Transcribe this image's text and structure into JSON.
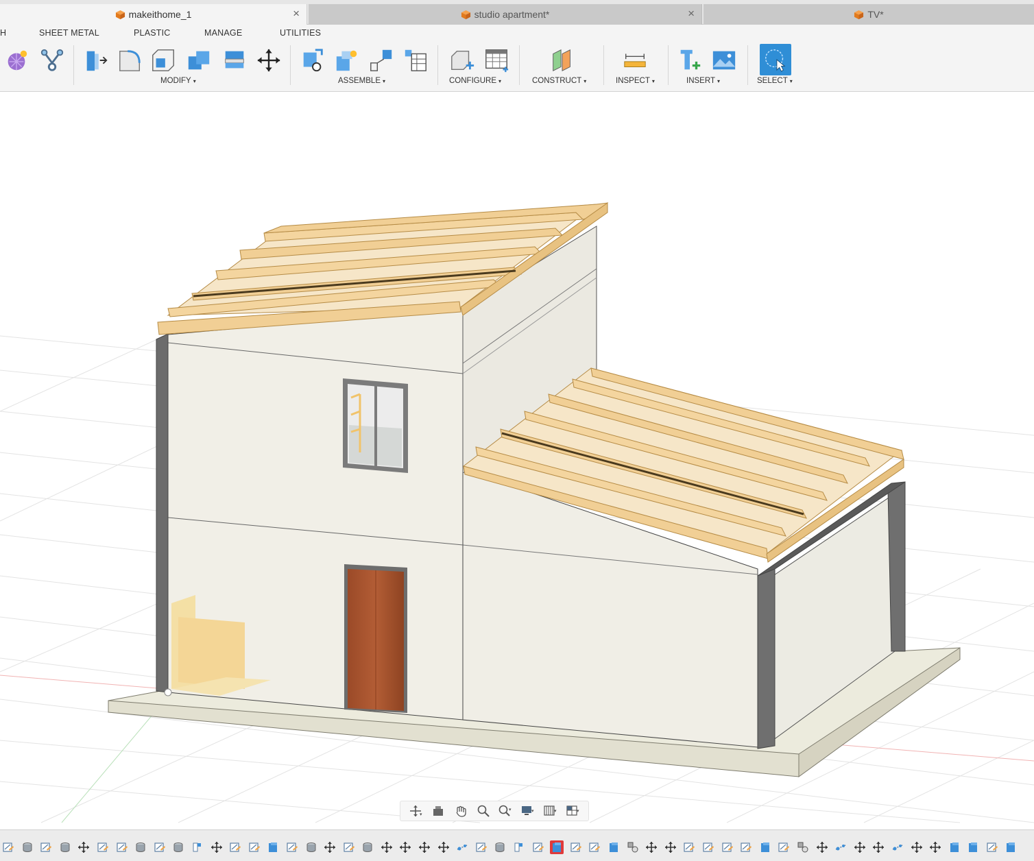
{
  "document_tabs": [
    {
      "label": "makeithome_1",
      "active": true,
      "close_icon": "×"
    },
    {
      "label": "studio apartment*",
      "active": false,
      "close_icon": "×"
    },
    {
      "label": "TV*",
      "active": false
    }
  ],
  "ribbon": {
    "tabs": [
      "H",
      "SHEET METAL",
      "PLASTIC",
      "MANAGE",
      "UTILITIES"
    ],
    "groups": {
      "modify": "MODIFY",
      "assemble": "ASSEMBLE",
      "configure": "CONFIGURE",
      "construct": "CONSTRUCT",
      "inspect": "INSPECT",
      "insert": "INSERT",
      "select": "SELECT"
    },
    "caret": "▾"
  },
  "navbar": {
    "tools": [
      "orbit-icon",
      "look-at-icon",
      "pan-icon",
      "zoom-icon",
      "fit-icon",
      "display-settings-icon",
      "grid-icon",
      "viewports-icon"
    ]
  },
  "timeline": {
    "items": [
      "sketch",
      "extrude",
      "sketch",
      "extrude",
      "move",
      "sketch",
      "sketch",
      "extrude",
      "sketch",
      "extrude",
      "plane",
      "move",
      "sketch",
      "sketch",
      "body",
      "sketch",
      "extrude",
      "move",
      "sketch",
      "extrude",
      "move",
      "move",
      "move",
      "move",
      "joint",
      "sketch",
      "extrude",
      "plane",
      "sketch",
      "body",
      "sketch",
      "sketch",
      "body",
      "component",
      "move",
      "move",
      "sketch",
      "sketch",
      "sketch",
      "sketch",
      "body",
      "sketch",
      "component",
      "move",
      "joint",
      "move",
      "move",
      "joint",
      "move",
      "move",
      "body",
      "body",
      "sketch",
      "body"
    ],
    "active_index": 29
  },
  "colors": {
    "accent": "#2f8ed6",
    "timeline_active": "#e03a3a",
    "roof_wood": "#f1cf95",
    "wall": "#f0eee6",
    "door_wood": "#a8522e"
  }
}
